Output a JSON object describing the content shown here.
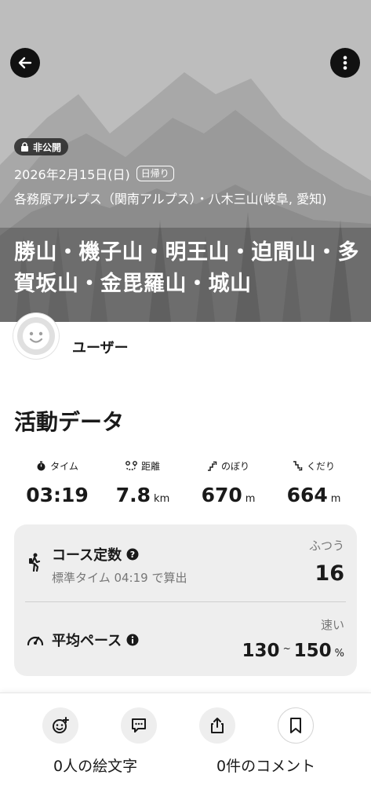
{
  "header": {
    "visibility_label": "非公開",
    "date": "2026年2月15日(日)",
    "day_type": "日帰り",
    "area": "各務原アルプス（関南アルプス）・八木三山(岐阜, 愛知)",
    "title": "勝山・機子山・明王山・迫間山・多賀坂山・金毘羅山・城山",
    "icons": [
      "arrow-left-icon",
      "more-vertical-icon",
      "lock-icon"
    ]
  },
  "user": {
    "name": "ユーザー"
  },
  "activity": {
    "section_title": "活動データ",
    "stats": [
      {
        "label": "タイム",
        "value": "03:19",
        "unit": "",
        "icon": "stopwatch-icon"
      },
      {
        "label": "距離",
        "value": "7.8",
        "unit": "km",
        "icon": "route-icon"
      },
      {
        "label": "のぼり",
        "value": "670",
        "unit": "m",
        "icon": "ascent-icon"
      },
      {
        "label": "くだり",
        "value": "664",
        "unit": "m",
        "icon": "descent-icon"
      }
    ],
    "course": {
      "title": "コース定数",
      "sub": "標準タイム 04:19 で算出",
      "level": "ふつう",
      "value": "16"
    },
    "pace": {
      "title": "平均ペース",
      "level": "速い",
      "value_min": "130",
      "tilde": "~",
      "value_max": "150",
      "unit": "%"
    }
  },
  "bottom": {
    "emoji_label": "0人の絵文字",
    "comment_label": "0件のコメント"
  },
  "colors": {
    "hero_bg": "#bdbdbd",
    "card_bg": "#eeeeee",
    "text": "#1a1a1a",
    "muted": "#777777"
  }
}
